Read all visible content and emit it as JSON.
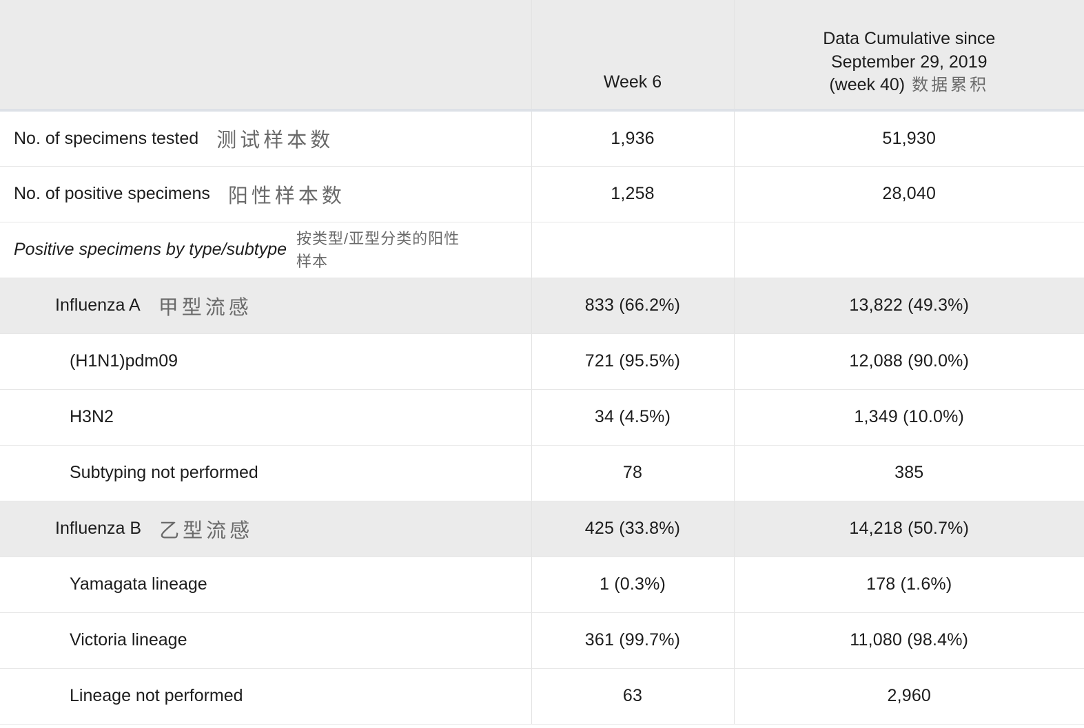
{
  "table": {
    "header": {
      "blank_label": "",
      "week_label": "Week 6",
      "cumulative_line1": "Data Cumulative since",
      "cumulative_line2": "September 29, 2019",
      "cumulative_line3": "(week 40)",
      "cumulative_zh": "数据累积"
    },
    "colors": {
      "header_bg": "#ebebeb",
      "shaded_row_bg": "#ebebeb",
      "row_border": "#e7e7e7",
      "header_rule": "#dde1e7",
      "text": "#1d1d1d",
      "zh_text": "#6a6a6a"
    },
    "rows": [
      {
        "label_en": "No. of specimens tested",
        "label_zh": "测试样本数",
        "zh_style": "inline",
        "indent": 0,
        "italic": false,
        "shaded": false,
        "week": "1,936",
        "cumulative": "51,930"
      },
      {
        "label_en": "No. of positive specimens",
        "label_zh": "阳性样本数",
        "zh_style": "inline",
        "indent": 0,
        "italic": false,
        "shaded": false,
        "week": "1,258",
        "cumulative": "28,040"
      },
      {
        "label_en": "Positive specimens by type/subtype",
        "label_zh": "按类型/亚型分类的阳性样本",
        "zh_style": "stack",
        "indent": 0,
        "italic": true,
        "shaded": false,
        "week": "",
        "cumulative": ""
      },
      {
        "label_en": "Influenza A",
        "label_zh": "甲型流感",
        "zh_style": "inline",
        "indent": 1,
        "italic": false,
        "shaded": true,
        "week": "833 (66.2%)",
        "cumulative": "13,822 (49.3%)"
      },
      {
        "label_en": "(H1N1)pdm09",
        "label_zh": "",
        "zh_style": "inline",
        "indent": 2,
        "italic": false,
        "shaded": false,
        "week": "721 (95.5%)",
        "cumulative": "12,088 (90.0%)"
      },
      {
        "label_en": "H3N2",
        "label_zh": "",
        "zh_style": "inline",
        "indent": 2,
        "italic": false,
        "shaded": false,
        "week": "34 (4.5%)",
        "cumulative": "1,349 (10.0%)"
      },
      {
        "label_en": "Subtyping not performed",
        "label_zh": "",
        "zh_style": "inline",
        "indent": 2,
        "italic": false,
        "shaded": false,
        "week": "78",
        "cumulative": "385"
      },
      {
        "label_en": "Influenza B",
        "label_zh": "乙型流感",
        "zh_style": "inline",
        "indent": 1,
        "italic": false,
        "shaded": true,
        "week": "425 (33.8%)",
        "cumulative": "14,218 (50.7%)"
      },
      {
        "label_en": "Yamagata lineage",
        "label_zh": "",
        "zh_style": "inline",
        "indent": 2,
        "italic": false,
        "shaded": false,
        "week": "1 (0.3%)",
        "cumulative": "178 (1.6%)"
      },
      {
        "label_en": "Victoria lineage",
        "label_zh": "",
        "zh_style": "inline",
        "indent": 2,
        "italic": false,
        "shaded": false,
        "week": "361 (99.7%)",
        "cumulative": "11,080 (98.4%)"
      },
      {
        "label_en": "Lineage not performed",
        "label_zh": "",
        "zh_style": "inline",
        "indent": 2,
        "italic": false,
        "shaded": false,
        "week": "63",
        "cumulative": "2,960"
      }
    ]
  }
}
